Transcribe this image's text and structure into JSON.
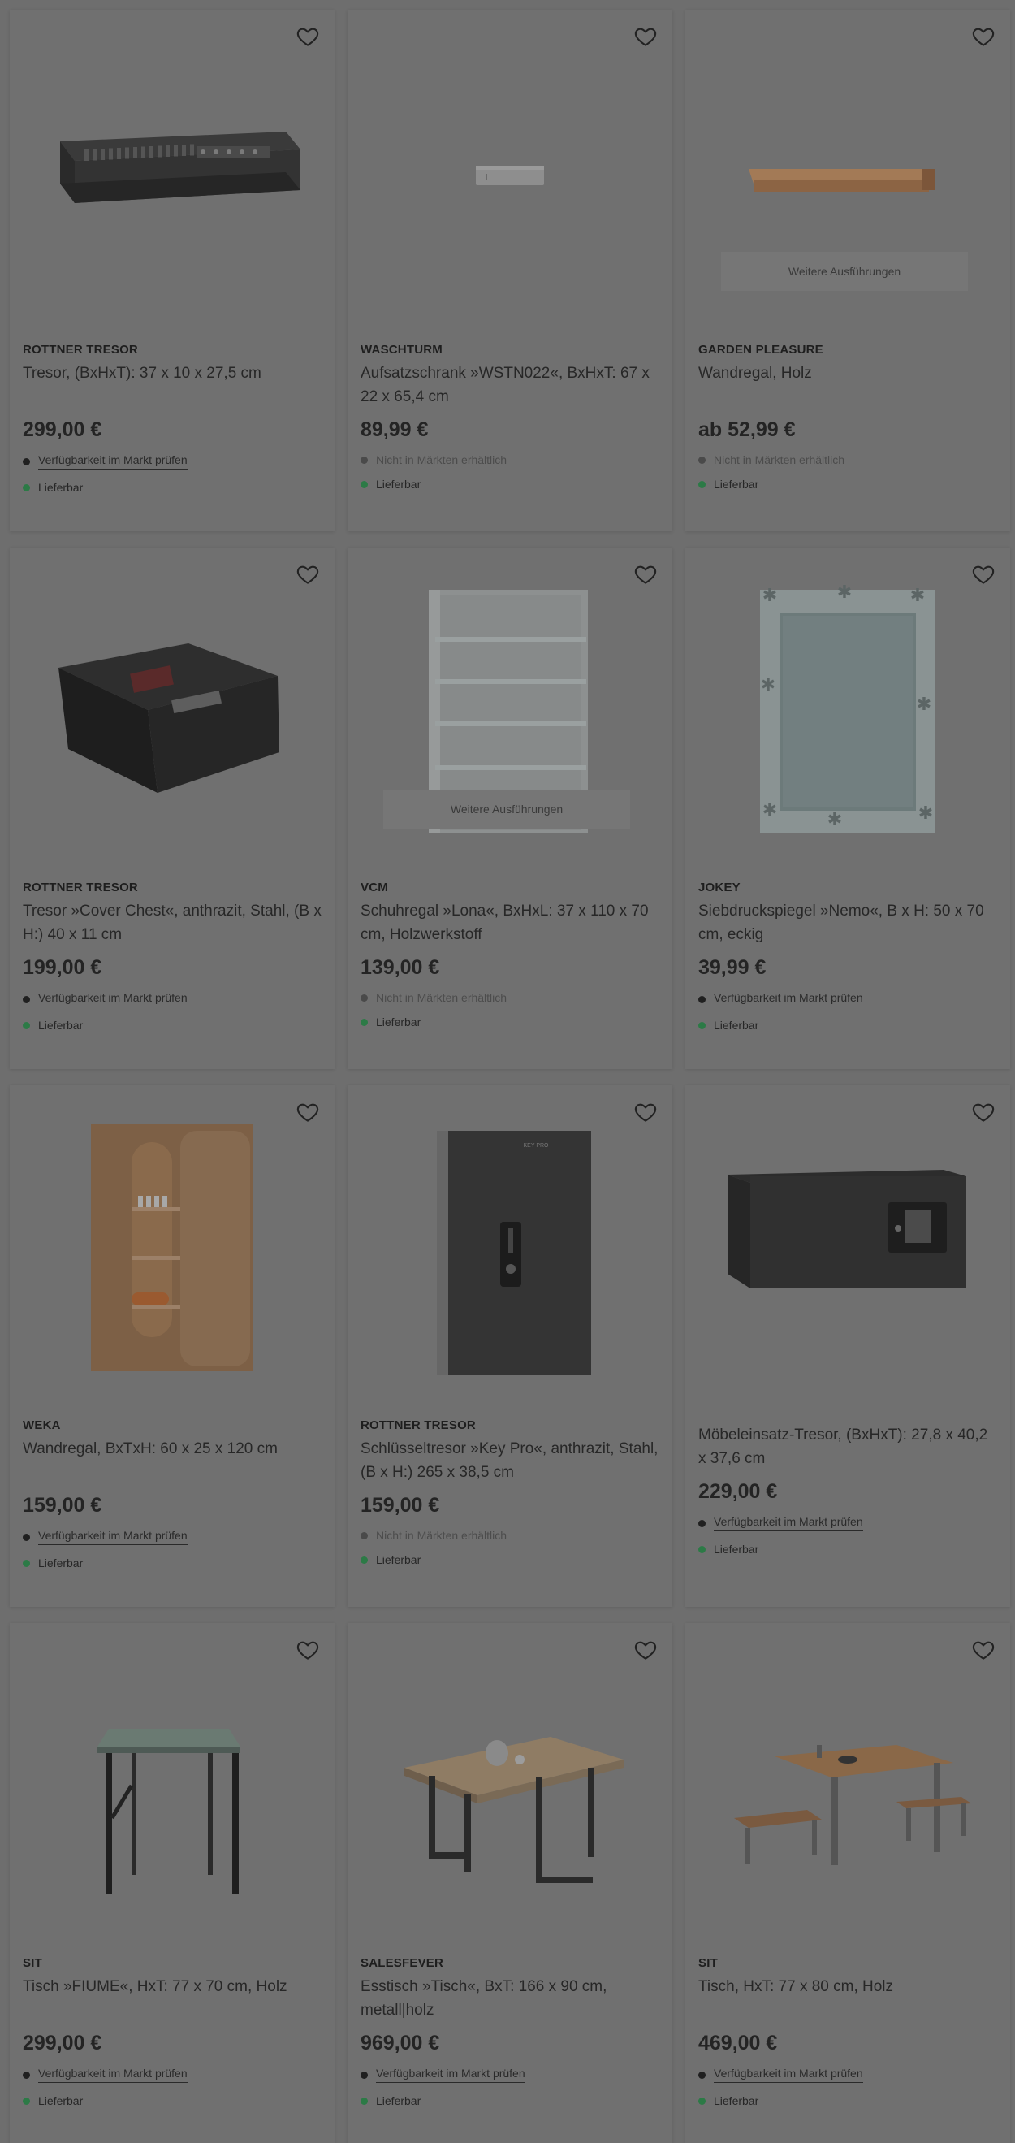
{
  "products": [
    {
      "brand": "ROTTNER TRESOR",
      "title": "Tresor, (BxHxT): 37 x 10 x 27,5 cm",
      "price": "299,00 €",
      "availability": "Verfügbarkeit im Markt prüfen",
      "availability_type": "link",
      "delivery": "Lieferbar",
      "variants_label": "",
      "image": "flat-safe"
    },
    {
      "brand": "WASCHTURM",
      "title": "Aufsatzschrank »WSTN022«, BxHxT: 67 x 22 x 65,4 cm",
      "price": "89,99 €",
      "availability": "Nicht in Märkten erhältlich",
      "availability_type": "none",
      "delivery": "Lieferbar",
      "variants_label": "",
      "image": "wall-cabinet"
    },
    {
      "brand": "GARDEN PLEASURE",
      "title": "Wandregal, Holz",
      "price": "ab 52,99 €",
      "availability": "Nicht in Märkten erhältlich",
      "availability_type": "none",
      "delivery": "Lieferbar",
      "variants_label": "Weitere Ausführungen",
      "image": "wall-shelf"
    },
    {
      "brand": "ROTTNER TRESOR",
      "title": "Tresor »Cover Chest«, anthrazit, Stahl, (B x H:) 40 x 11 cm",
      "price": "199,00 €",
      "availability": "Verfügbarkeit im Markt prüfen",
      "availability_type": "link",
      "delivery": "Lieferbar",
      "variants_label": "",
      "image": "chest-safe"
    },
    {
      "brand": "VCM",
      "title": "Schuhregal »Lona«, BxHxL: 37 x 110 x 70 cm, Holzwerkstoff",
      "price": "139,00 €",
      "availability": "Nicht in Märkten erhältlich",
      "availability_type": "none",
      "delivery": "Lieferbar",
      "variants_label": "Weitere Ausführungen",
      "image": "shoe-rack"
    },
    {
      "brand": "JOKEY",
      "title": "Siebdruckspiegel »Nemo«, B x H: 50 x 70 cm, eckig",
      "price": "39,99 €",
      "availability": "Verfügbarkeit im Markt prüfen",
      "availability_type": "link",
      "delivery": "Lieferbar",
      "variants_label": "",
      "image": "mirror"
    },
    {
      "brand": "WEKA",
      "title": "Wandregal, BxTxH: 60 x 25 x 120 cm",
      "price": "159,00 €",
      "availability": "Verfügbarkeit im Markt prüfen",
      "availability_type": "link",
      "delivery": "Lieferbar",
      "variants_label": "",
      "image": "sauna-shelf"
    },
    {
      "brand": "ROTTNER TRESOR",
      "title": "Schlüsseltresor »Key Pro«, anthrazit, Stahl, (B x H:) 265 x 38,5 cm",
      "price": "159,00 €",
      "availability": "Nicht in Märkten erhältlich",
      "availability_type": "none",
      "delivery": "Lieferbar",
      "variants_label": "",
      "image": "key-safe"
    },
    {
      "brand": "",
      "title": "Möbeleinsatz-Tresor, (BxHxT): 27,8 x 40,2 x 37,6 cm",
      "price": "229,00 €",
      "availability": "Verfügbarkeit im Markt prüfen",
      "availability_type": "link",
      "delivery": "Lieferbar",
      "variants_label": "",
      "image": "box-safe"
    },
    {
      "brand": "SIT",
      "title": "Tisch »FIUME«, HxT: 77 x 70 cm, Holz",
      "price": "299,00 €",
      "availability": "Verfügbarkeit im Markt prüfen",
      "availability_type": "link",
      "delivery": "Lieferbar",
      "variants_label": "",
      "image": "bar-table"
    },
    {
      "brand": "SALESFEVER",
      "title": "Esstisch »Tisch«, BxT: 166 x 90 cm, metall|holz",
      "price": "969,00 €",
      "availability": "Verfügbarkeit im Markt prüfen",
      "availability_type": "link",
      "delivery": "Lieferbar",
      "variants_label": "",
      "image": "dining-table"
    },
    {
      "brand": "SIT",
      "title": "Tisch, HxT: 77 x 80 cm, Holz",
      "price": "469,00 €",
      "availability": "Verfügbarkeit im Markt prüfen",
      "availability_type": "link",
      "delivery": "Lieferbar",
      "variants_label": "",
      "image": "table-benches"
    }
  ],
  "colors": {
    "overlay_bg": "#6e6e6e",
    "card_bg": "#707070",
    "in_stock_dot": "#2c7a46"
  }
}
